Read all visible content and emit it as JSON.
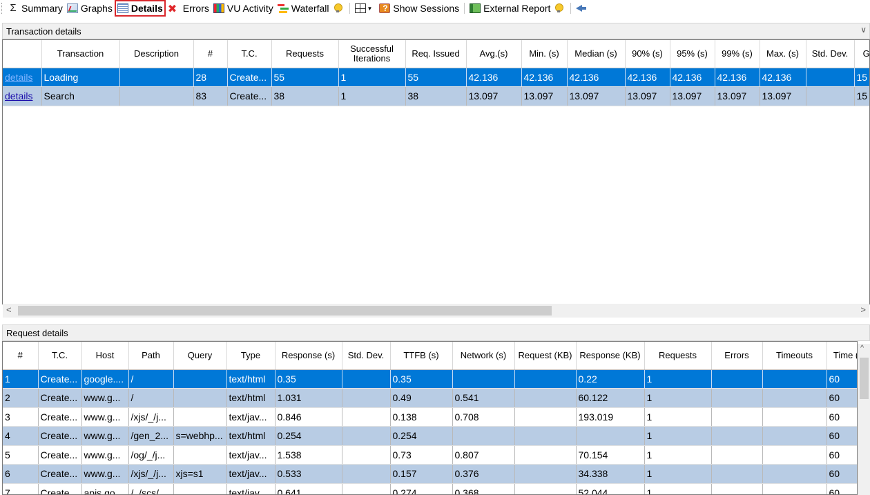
{
  "toolbar": {
    "summary": "Summary",
    "graphs": "Graphs",
    "details": "Details",
    "errors": "Errors",
    "vu_activity": "VU Activity",
    "waterfall": "Waterfall",
    "show_sessions": "Show Sessions",
    "external_report": "External Report",
    "sigma": "Σ"
  },
  "transaction_panel": {
    "title": "Transaction details",
    "headers": [
      "",
      "Transaction",
      "Description",
      "#",
      "T.C.",
      "Requests",
      "Successful Iterations",
      "Req. Issued",
      "Avg.(s)",
      "Min. (s)",
      "Median (s)",
      "90% (s)",
      "95% (s)",
      "99% (s)",
      "Max. (s)",
      "Std. Dev.",
      "Go (s"
    ],
    "rows": [
      [
        "details",
        "Loading",
        "",
        "28",
        "Create...",
        "55",
        "1",
        "55",
        "42.136",
        "42.136",
        "42.136",
        "42.136",
        "42.136",
        "42.136",
        "42.136",
        "",
        "15"
      ],
      [
        "details",
        "Search",
        "",
        "83",
        "Create...",
        "38",
        "1",
        "38",
        "13.097",
        "13.097",
        "13.097",
        "13.097",
        "13.097",
        "13.097",
        "13.097",
        "",
        "15"
      ]
    ]
  },
  "request_panel": {
    "title": "Request details",
    "headers": [
      "#",
      "T.C.",
      "Host",
      "Path",
      "Query",
      "Type",
      "Response (s)",
      "Std. Dev.",
      "TTFB (s)",
      "Network (s)",
      "Request (KB)",
      "Response (KB)",
      "Requests",
      "Errors",
      "Timeouts",
      "Time (s)"
    ],
    "rows": [
      [
        "1",
        "Create...",
        "google....",
        "/",
        "",
        "text/html",
        "0.35",
        "",
        "0.35",
        "",
        "",
        "0.22",
        "1",
        "",
        "",
        "60"
      ],
      [
        "2",
        "Create...",
        "www.g...",
        "/",
        "",
        "text/html",
        "1.031",
        "",
        "0.49",
        "0.541",
        "",
        "60.122",
        "1",
        "",
        "",
        "60"
      ],
      [
        "3",
        "Create...",
        "www.g...",
        "/xjs/_/j...",
        "",
        "text/jav...",
        "0.846",
        "",
        "0.138",
        "0.708",
        "",
        "193.019",
        "1",
        "",
        "",
        "60"
      ],
      [
        "4",
        "Create...",
        "www.g...",
        "/gen_2...",
        "s=webhp...",
        "text/html",
        "0.254",
        "",
        "0.254",
        "",
        "",
        "",
        "1",
        "",
        "",
        "60"
      ],
      [
        "5",
        "Create...",
        "www.g...",
        "/og/_/j...",
        "",
        "text/jav...",
        "1.538",
        "",
        "0.73",
        "0.807",
        "",
        "70.154",
        "1",
        "",
        "",
        "60"
      ],
      [
        "6",
        "Create...",
        "www.g...",
        "/xjs/_/j...",
        "xjs=s1",
        "text/jav...",
        "0.533",
        "",
        "0.157",
        "0.376",
        "",
        "34.338",
        "1",
        "",
        "",
        "60"
      ],
      [
        "7",
        "Create...",
        "apis.go...",
        "/_/scs/...",
        "",
        "text/jav...",
        "0.641",
        "",
        "0.274",
        "0.368",
        "",
        "52.044",
        "1",
        "",
        "",
        "60"
      ]
    ]
  }
}
